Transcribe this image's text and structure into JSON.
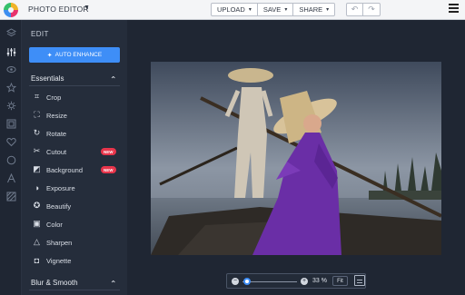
{
  "app": {
    "title": "PHOTO EDITOR",
    "caret": "▼"
  },
  "toolbar": {
    "upload_label": "UPLOAD",
    "save_label": "SAVE",
    "share_label": "SHARE",
    "caret": "▾",
    "undo_glyph": "↶",
    "redo_glyph": "↷"
  },
  "rail": {
    "icons": [
      "layers-icon",
      "sliders-icon",
      "eye-icon",
      "star-icon",
      "gear-icon",
      "frame-icon",
      "heart-icon",
      "circle-icon",
      "text-icon",
      "texture-icon"
    ]
  },
  "panel": {
    "title": "EDIT",
    "auto_enhance_label": "AUTO ENHANCE",
    "essentials_label": "Essentials",
    "blur_label": "Blur & Smooth",
    "new_badge": "NEW",
    "tools": [
      {
        "label": "Crop",
        "icon": "crop-icon",
        "glyph": "⌗"
      },
      {
        "label": "Resize",
        "icon": "resize-icon",
        "glyph": "⛶"
      },
      {
        "label": "Rotate",
        "icon": "rotate-icon",
        "glyph": "↻"
      },
      {
        "label": "Cutout",
        "icon": "scissors-icon",
        "glyph": "✂",
        "badge": "NEW"
      },
      {
        "label": "Background",
        "icon": "background-icon",
        "glyph": "◩",
        "badge": "NEW"
      },
      {
        "label": "Exposure",
        "icon": "exposure-icon",
        "glyph": "◑"
      },
      {
        "label": "Beautify",
        "icon": "beautify-icon",
        "glyph": "✪"
      },
      {
        "label": "Color",
        "icon": "color-icon",
        "glyph": "▣"
      },
      {
        "label": "Sharpen",
        "icon": "sharpen-icon",
        "glyph": "△"
      },
      {
        "label": "Vignette",
        "icon": "vignette-icon",
        "glyph": "◘"
      }
    ]
  },
  "zoom": {
    "percent_label": "33 %",
    "fit_label": "Fit",
    "level": 0.33,
    "minus": "−",
    "plus": "+"
  },
  "colors": {
    "accent": "#3e8ef7",
    "badge": "#e8354b",
    "panel": "#252d3b",
    "rail": "#1f2633"
  }
}
